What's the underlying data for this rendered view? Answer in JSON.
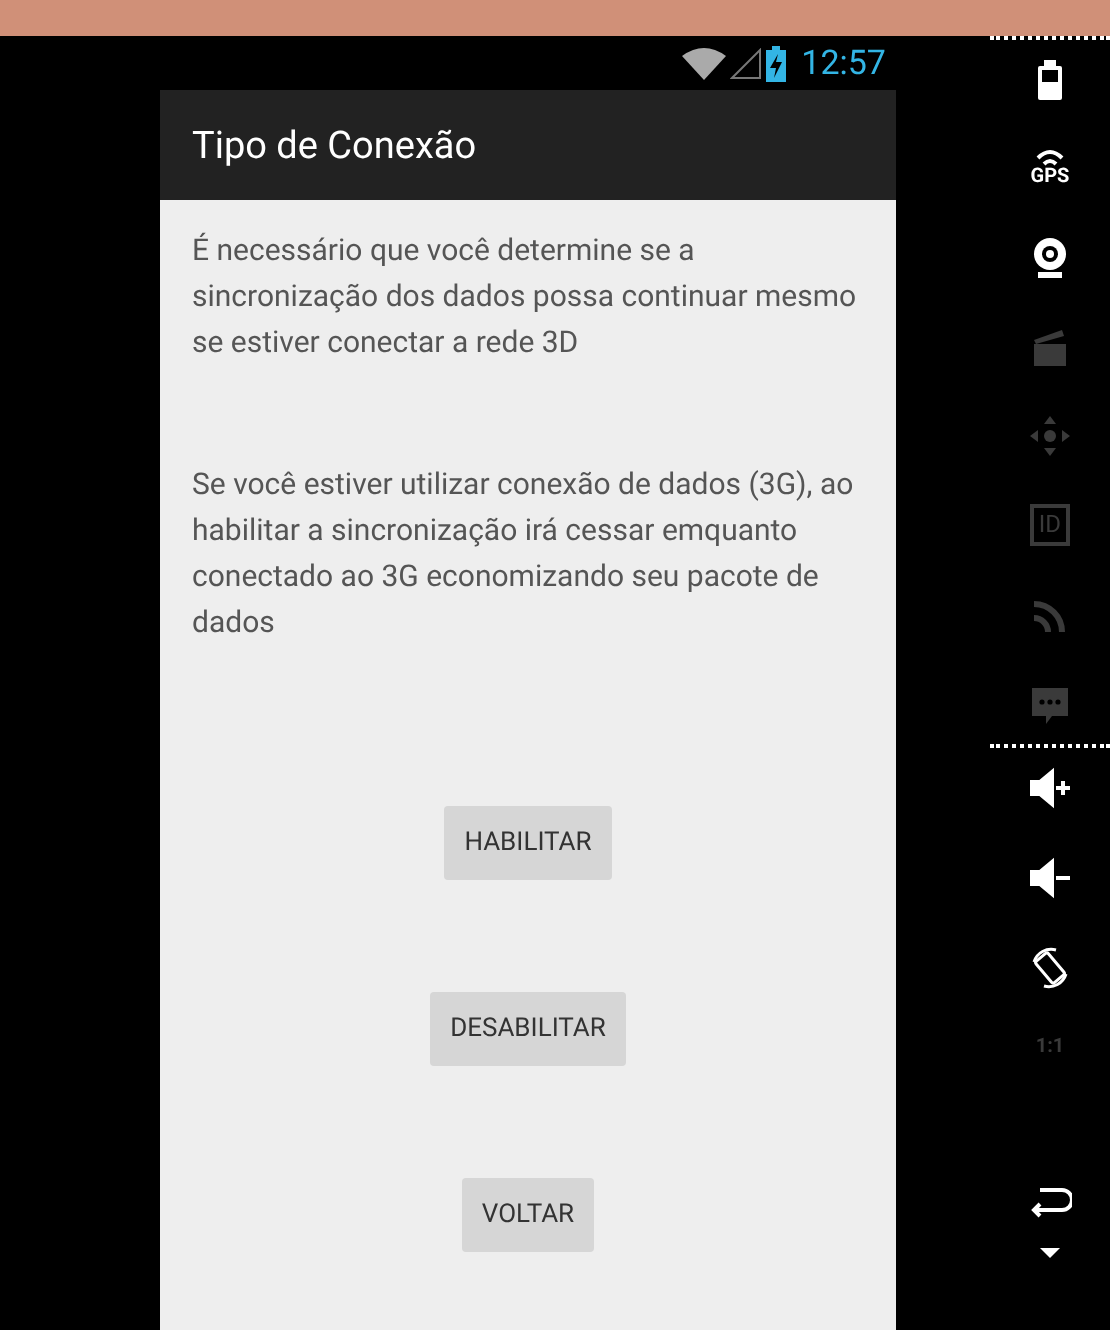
{
  "status_bar": {
    "time": "12:57",
    "wifi": true,
    "charging": true
  },
  "dialog": {
    "title": "Tipo de Conexão",
    "paragraphs": [
      "É necessário que você determine se a sincronização dos dados possa continuar mesmo se estiver conectar a rede 3D",
      "Se você estiver utilizar conexão de dados (3G), ao habilitar a sincronização irá cessar emquanto conectado ao 3G economizando seu pacote de dados"
    ],
    "buttons": [
      "HABILITAR",
      "DESABILITAR",
      "VOLTAR"
    ]
  },
  "toolbar": [
    {
      "kind": "battery",
      "disabled": false
    },
    {
      "kind": "gps",
      "label": "GPS",
      "disabled": false
    },
    {
      "kind": "webcam",
      "disabled": false
    },
    {
      "kind": "clapper",
      "disabled": true
    },
    {
      "kind": "dpad",
      "disabled": true
    },
    {
      "kind": "id",
      "label": "ID",
      "disabled": true
    },
    {
      "kind": "rss",
      "disabled": true
    },
    {
      "kind": "message",
      "disabled": true
    },
    {
      "kind": "divider"
    },
    {
      "kind": "volup",
      "disabled": false
    },
    {
      "kind": "voldown",
      "disabled": false
    },
    {
      "kind": "rotate",
      "disabled": false
    },
    {
      "kind": "scale",
      "label": "1:1",
      "disabled": true
    },
    {
      "kind": "spacer"
    },
    {
      "kind": "back",
      "disabled": false
    },
    {
      "kind": "more",
      "disabled": false
    }
  ]
}
